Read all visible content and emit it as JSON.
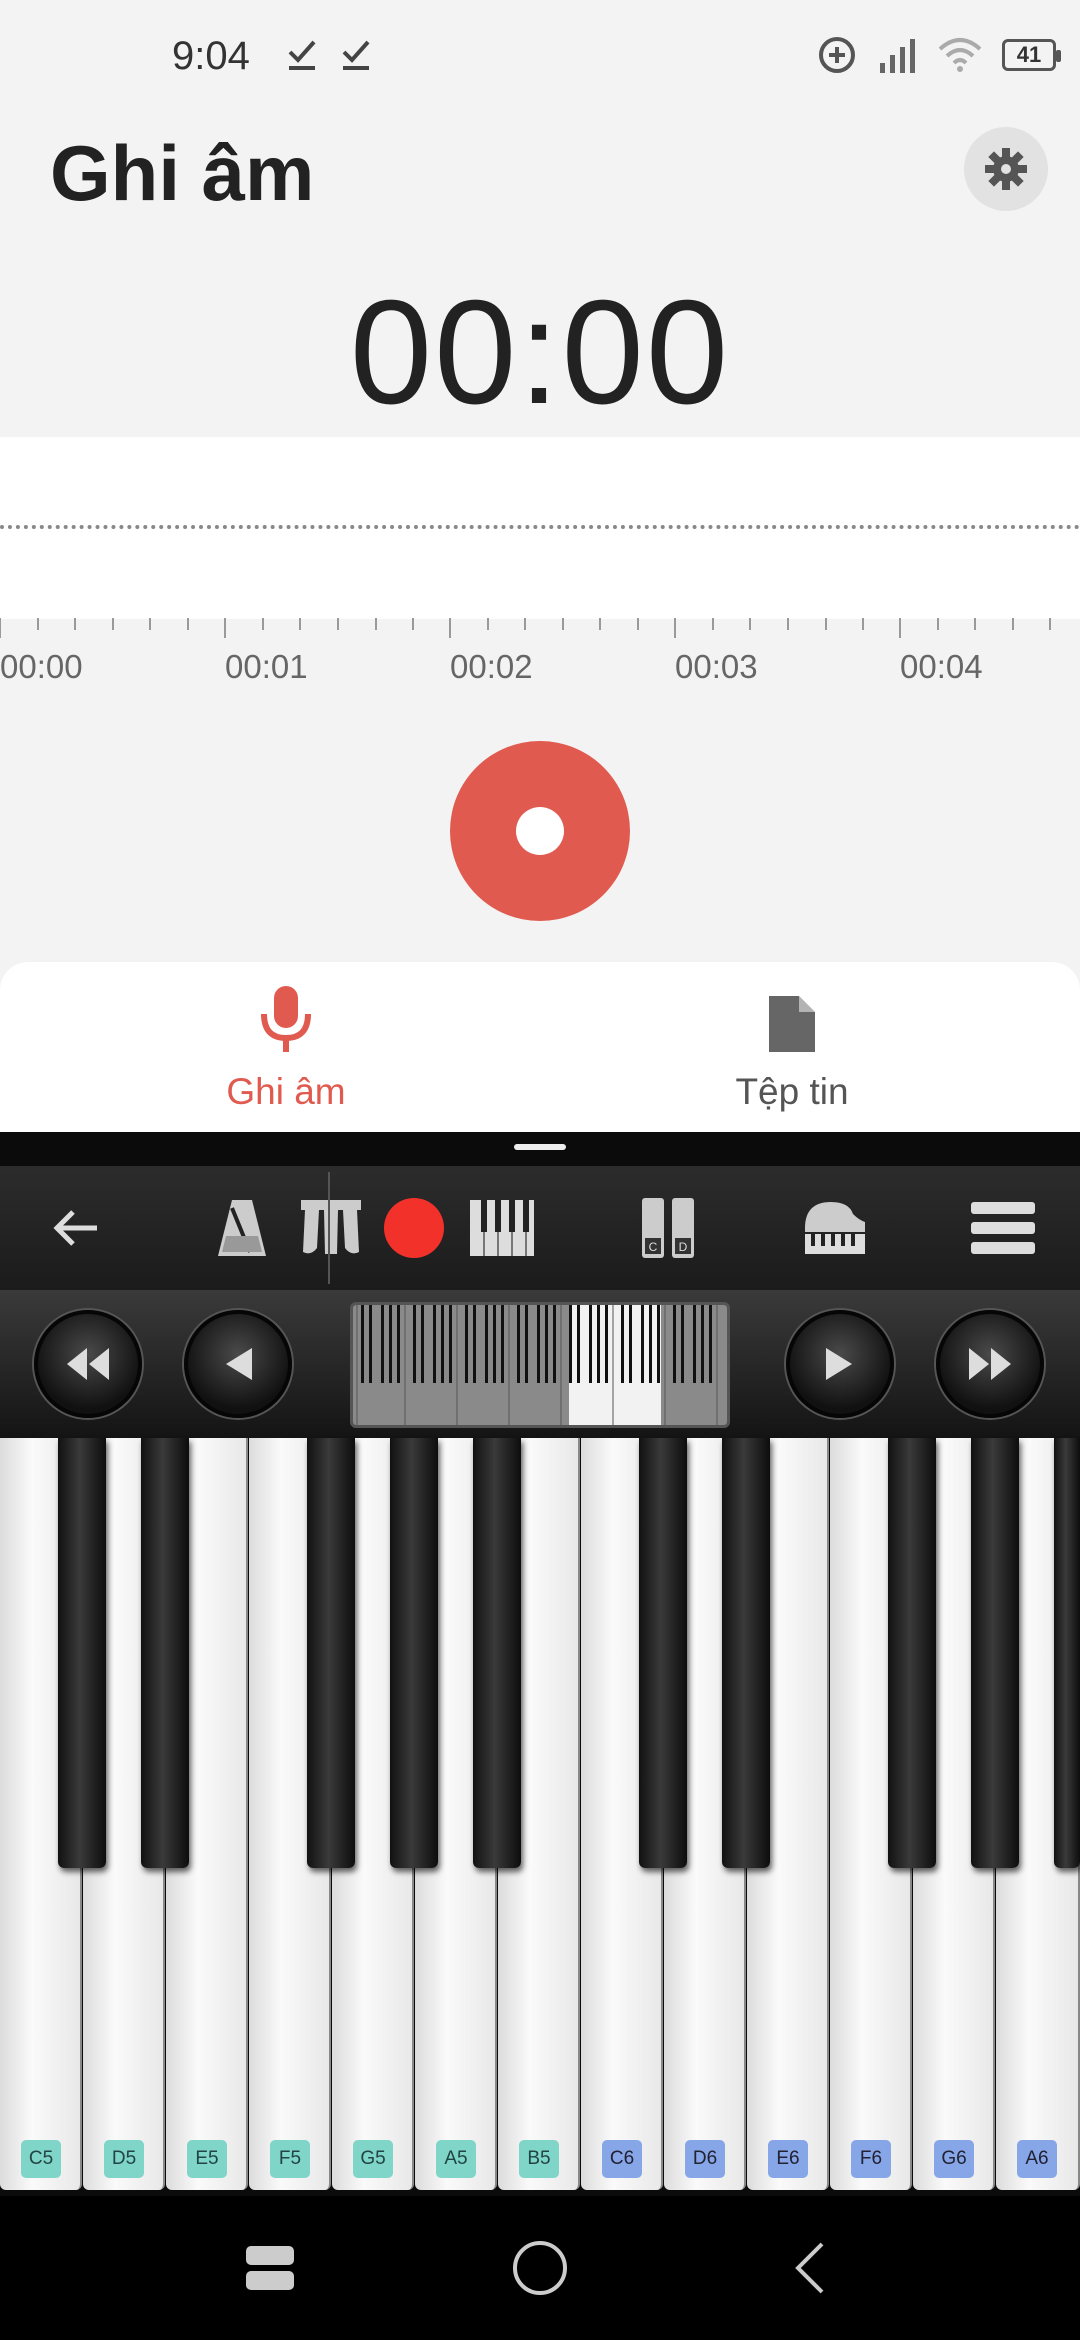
{
  "status_bar": {
    "time": "9:04",
    "battery": "41",
    "icons": [
      "check-icon",
      "check-icon",
      "sync-plus-icon",
      "signal-icon",
      "wifi-icon",
      "battery-icon"
    ]
  },
  "recorder": {
    "title": "Ghi âm",
    "timer": "00:00",
    "ruler_labels": [
      "00:00",
      "00:01",
      "00:02",
      "00:03",
      "00:04"
    ],
    "accent_color": "#e05a4f"
  },
  "tabs": [
    {
      "label": "Ghi âm",
      "icon": "microphone-icon",
      "active": true
    },
    {
      "label": "Tệp tin",
      "icon": "file-icon",
      "active": false
    }
  ],
  "piano": {
    "toolbar_icons": [
      "back-arrow-icon",
      "metronome-icon",
      "pedal-icon",
      "record-icon",
      "keys-layout-icon",
      "dual-keyboard-icon",
      "grand-piano-icon",
      "menu-icon"
    ],
    "white_keys": [
      "C5",
      "D5",
      "E5",
      "F5",
      "G5",
      "A5",
      "B5",
      "C6",
      "D6",
      "E6",
      "F6",
      "G6",
      "A6"
    ]
  }
}
